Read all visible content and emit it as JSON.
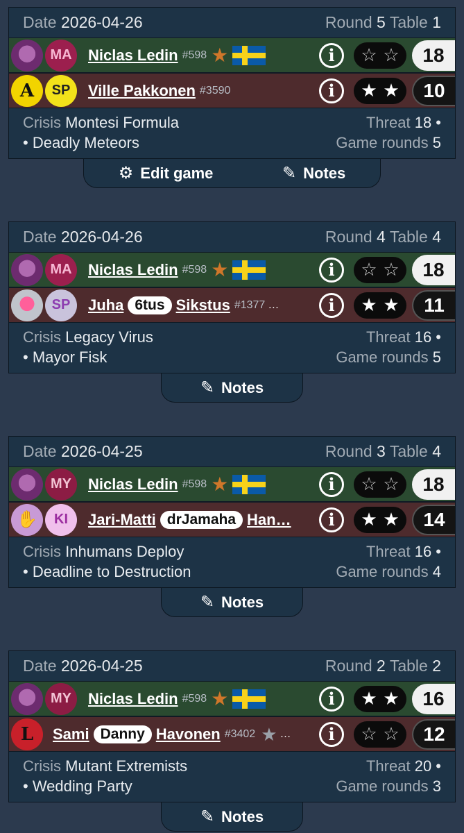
{
  "labels": {
    "date": "Date",
    "round": "Round",
    "table": "Table",
    "crisis": "Crisis",
    "threat": "Threat",
    "game_rounds": "Game rounds",
    "edit_game": "Edit game",
    "notes": "Notes"
  },
  "games": [
    {
      "date": "2026-04-26",
      "round": "5",
      "table": "1",
      "p1": {
        "team": "MA",
        "name": "Niclas Ledin",
        "id": "#598",
        "stars": [
          "empty",
          "empty"
        ],
        "score": "18",
        "hero": "magneto"
      },
      "p2": {
        "team": "SP",
        "name_pre": "Ville Pakkonen",
        "nick": "",
        "name_post": "",
        "id": "#3590",
        "stars": [
          "full",
          "full"
        ],
        "score": "10",
        "hero": "avengers"
      },
      "crisis": "Montesi Formula",
      "scheme": "• Deadly Meteors",
      "threat": "18 •",
      "game_rounds": "5",
      "has_edit": true
    },
    {
      "date": "2026-04-26",
      "round": "4",
      "table": "4",
      "p1": {
        "team": "MA",
        "name": "Niclas Ledin",
        "id": "#598",
        "stars": [
          "empty",
          "empty"
        ],
        "score": "18",
        "hero": "magneto"
      },
      "p2": {
        "team": "SP",
        "name_pre": "Juha",
        "nick": "6tus",
        "name_post": "Sikstus",
        "id": "#1377",
        "stars": [
          "full",
          "full"
        ],
        "score": "11",
        "hero": "magenta"
      },
      "crisis": "Legacy Virus",
      "scheme": "• Mayor Fisk",
      "threat": "16 •",
      "game_rounds": "5",
      "has_edit": false
    },
    {
      "date": "2026-04-25",
      "round": "3",
      "table": "4",
      "p1": {
        "team": "MY",
        "name": "Niclas Ledin",
        "id": "#598",
        "stars": [
          "empty",
          "empty"
        ],
        "score": "18",
        "hero": "magneto"
      },
      "p2": {
        "team": "KI",
        "name_pre": "Jari-Matti",
        "nick": "drJamaha",
        "name_post": "Han…",
        "id": "",
        "stars": [
          "full",
          "full"
        ],
        "score": "14",
        "hero": "purple"
      },
      "crisis": "Inhumans Deploy",
      "scheme": "• Deadline to Destruction",
      "threat": "16 •",
      "game_rounds": "4",
      "has_edit": false
    },
    {
      "date": "2026-04-25",
      "round": "2",
      "table": "2",
      "p1": {
        "team": "MY",
        "name": "Niclas Ledin",
        "id": "#598",
        "stars": [
          "full",
          "full"
        ],
        "score": "16",
        "hero": "magneto"
      },
      "p2": {
        "team": "",
        "name_pre": "Sami",
        "nick": "Danny",
        "name_post": "Havonen",
        "id": "#3402",
        "stars": [
          "empty",
          "empty"
        ],
        "score": "12",
        "hero": "red"
      },
      "crisis": "Mutant Extremists",
      "scheme": "• Wedding Party",
      "threat": "20 •",
      "game_rounds": "3",
      "has_edit": false
    }
  ]
}
